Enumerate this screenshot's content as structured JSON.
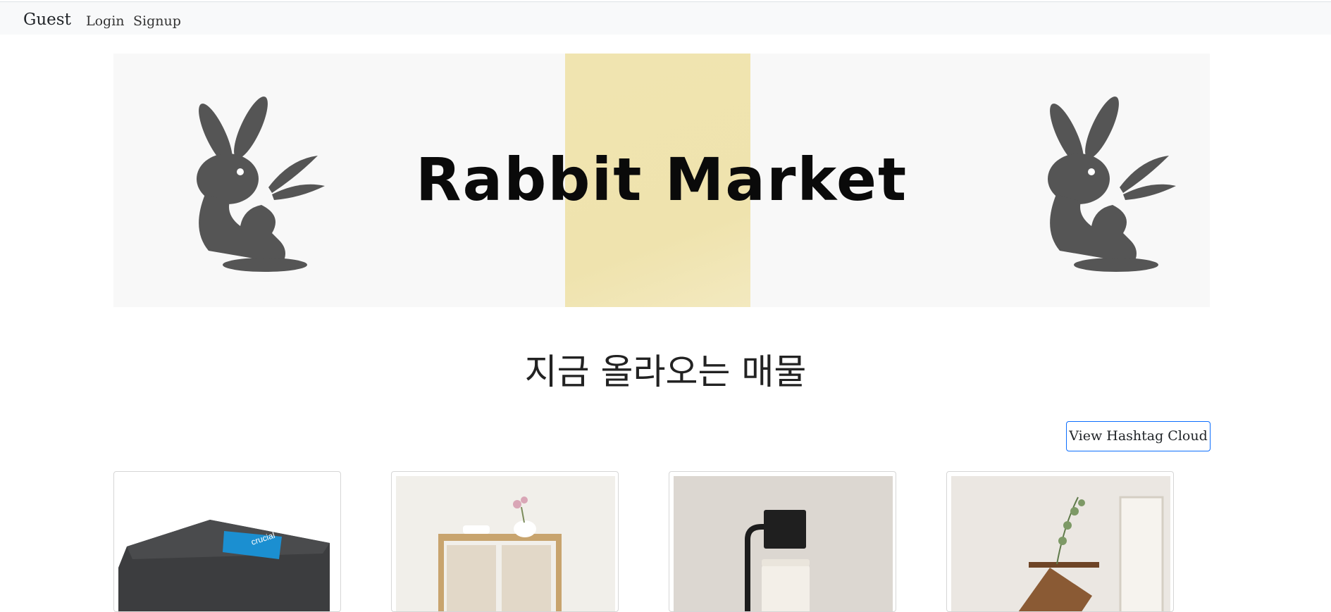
{
  "navbar": {
    "brand": "Guest",
    "links": [
      "Login",
      "Signup"
    ]
  },
  "banner": {
    "title": "Rabbit Market",
    "stripe_color": "#efe3ae",
    "rabbit_color": "#555555"
  },
  "main": {
    "heading": "지금 올라오는 매물",
    "hashtag_button": "View Hashtag Cloud"
  },
  "products": [
    {
      "image": "ssd-drive-photo"
    },
    {
      "image": "laundry-hamper-photo"
    },
    {
      "image": "candle-lamp-photo"
    },
    {
      "image": "plant-vase-stand-photo"
    }
  ],
  "colors": {
    "navbar_bg": "#f8f9fa",
    "button_border": "#0d6efd"
  }
}
